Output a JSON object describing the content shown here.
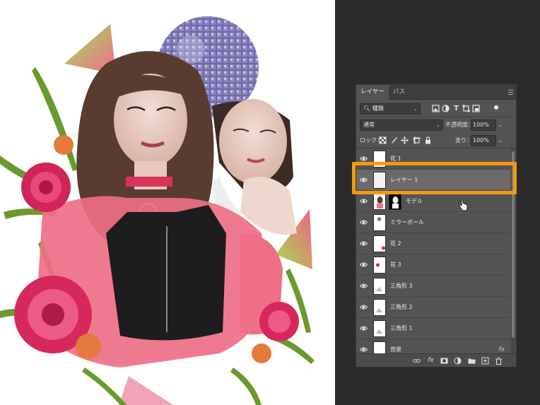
{
  "panel": {
    "tabs": [
      {
        "label": "レイヤー",
        "active": true
      },
      {
        "label": "パス",
        "active": false
      }
    ],
    "filter": {
      "kind_label": "種類"
    },
    "blend": {
      "mode": "通常",
      "opacity_label": "不透明度：",
      "opacity_value": "100%"
    },
    "lock": {
      "label": "ロック：",
      "fill_label": "塗り：",
      "fill_value": "100%"
    },
    "layers": [
      {
        "name": "花 1",
        "visible": true,
        "selected": false,
        "thumb": "flower"
      },
      {
        "name": "レイヤー 1",
        "visible": true,
        "selected": true,
        "thumb": "blank"
      },
      {
        "name": "モデル",
        "visible": true,
        "selected": false,
        "thumb": "model",
        "has_mask": true
      },
      {
        "name": "ミラーボール",
        "visible": true,
        "selected": false,
        "thumb": "ball"
      },
      {
        "name": "花 2",
        "visible": true,
        "selected": false,
        "thumb": "flower"
      },
      {
        "name": "花 3",
        "visible": true,
        "selected": false,
        "thumb": "flower"
      },
      {
        "name": "三角形 3",
        "visible": true,
        "selected": false,
        "thumb": "triangle"
      },
      {
        "name": "三角形 2",
        "visible": true,
        "selected": false,
        "thumb": "triangle"
      },
      {
        "name": "三角形 1",
        "visible": true,
        "selected": false,
        "thumb": "triangle"
      },
      {
        "name": "背景",
        "visible": true,
        "selected": false,
        "thumb": "blank",
        "fx": "fx"
      }
    ]
  },
  "colors": {
    "highlight": "#f39a11",
    "panel_bg": "#535353",
    "selected_row": "#6a6a6a",
    "workspace_bg": "#2b2b2b"
  },
  "icons": {
    "filter": [
      "search-icon",
      "chevron-down-icon",
      "image-filter-icon",
      "adjustment-filter-icon",
      "type-filter-icon",
      "shape-filter-icon",
      "smart-object-filter-icon",
      "filter-toggle-icon"
    ],
    "lock": [
      "lock-transparent-icon",
      "lock-image-icon",
      "lock-position-icon",
      "lock-artboard-icon",
      "lock-all-icon"
    ],
    "footer": [
      "link-icon",
      "fx-icon",
      "mask-icon",
      "adjustment-layer-icon",
      "folder-icon",
      "new-layer-icon",
      "trash-icon"
    ]
  }
}
